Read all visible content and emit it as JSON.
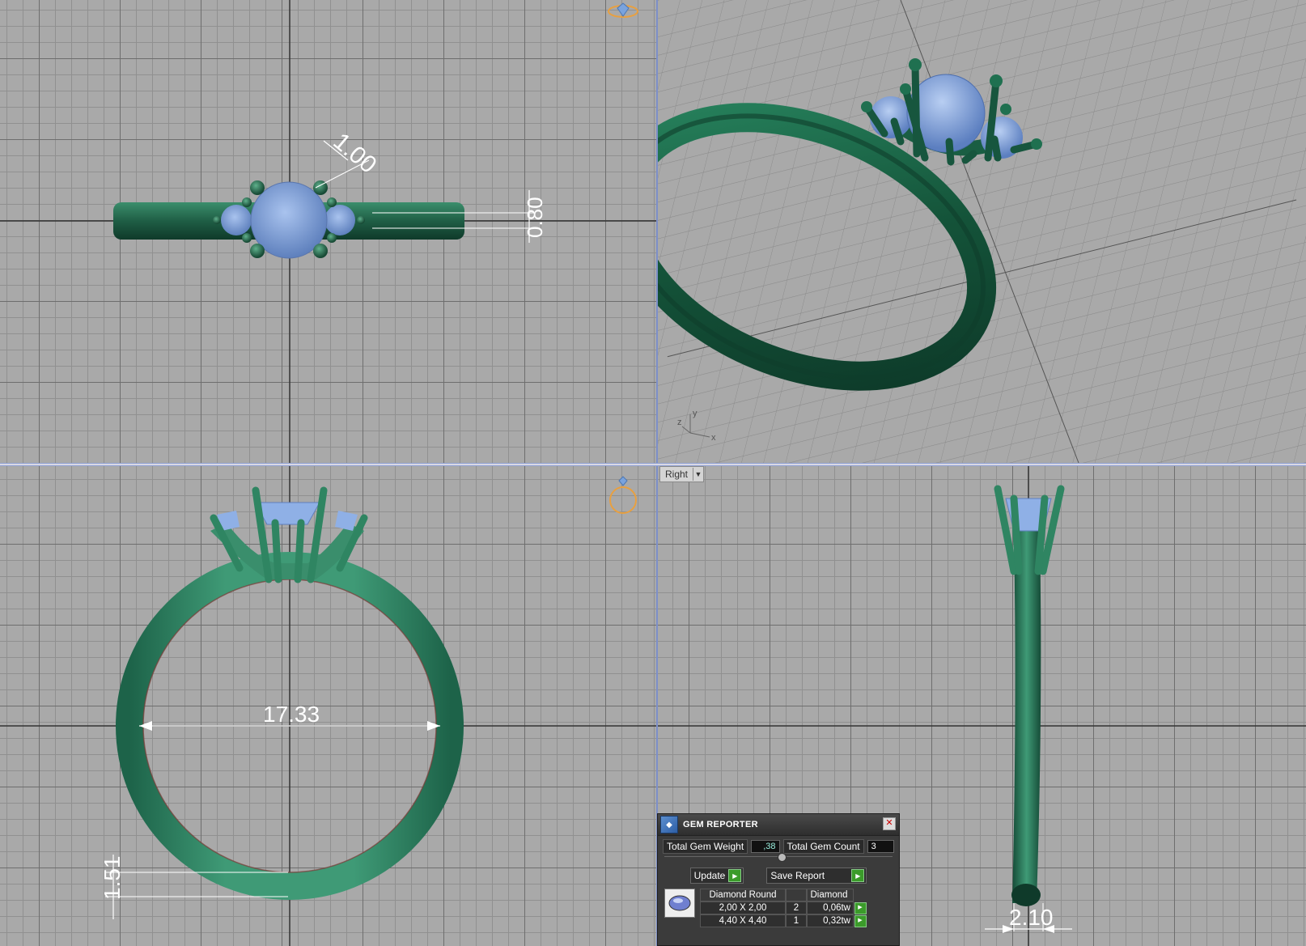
{
  "viewports": {
    "top": {
      "dimension_width": "1.00",
      "dimension_height": "0.80"
    },
    "front": {
      "dimension_inner": "17.33",
      "dimension_band": "1.51"
    },
    "right": {
      "label": "Right",
      "dimension_width": "2.10"
    },
    "perspective": {
      "axis_y": "y",
      "axis_x": "x",
      "axis_z": "z"
    }
  },
  "gem_reporter": {
    "title": "GEM REPORTER",
    "total_weight_label": "Total Gem Weight",
    "total_weight_value": ",38",
    "total_count_label": "Total Gem Count",
    "total_count_value": "3",
    "update_label": "Update",
    "save_report_label": "Save Report",
    "table": {
      "headers": [
        "Diamond Round",
        "",
        "Diamond"
      ],
      "rows": [
        {
          "size": "2,00 X 2,00",
          "count": "2",
          "weight": "0,06tw"
        },
        {
          "size": "4,40 X 4,40",
          "count": "1",
          "weight": "0,32tw"
        }
      ]
    }
  },
  "colors": {
    "metal": "#2e7a5c",
    "gem": "#7a9fd8",
    "grid_bg": "#a9a9a9",
    "accent_orange": "#e8a040"
  }
}
